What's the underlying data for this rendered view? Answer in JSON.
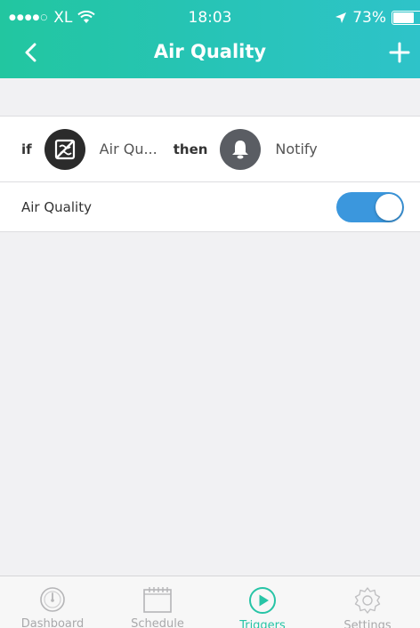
{
  "status_bar": {
    "signal_dots": "●●●●○",
    "carrier": "XL",
    "time": "18:03",
    "battery": "73%",
    "battery_level": 0.73
  },
  "nav": {
    "title": "Air Quality",
    "back_icon": "chevron-left-icon",
    "add_icon": "plus-icon"
  },
  "rule": {
    "if_label": "if",
    "condition_icon": "air-quality-icon",
    "condition_text": "Air Qu...",
    "then_label": "then",
    "action_icon": "bell-icon",
    "action_text": "Notify"
  },
  "toggle_row": {
    "label": "Air Quality",
    "enabled": true
  },
  "tabs": [
    {
      "label": "Dashboard",
      "icon": "gauge-icon",
      "active": false
    },
    {
      "label": "Schedule",
      "icon": "calendar-icon",
      "active": false
    },
    {
      "label": "Triggers",
      "icon": "play-circle-icon",
      "active": true
    },
    {
      "label": "Settings",
      "icon": "gear-icon",
      "active": false
    }
  ],
  "colors": {
    "header_gradient_start": "#22c6a0",
    "header_gradient_end": "#2ec3c9",
    "toggle_on": "#3b97dd",
    "tab_active": "#27c4a6",
    "tab_inactive": "#a9a9ab"
  }
}
